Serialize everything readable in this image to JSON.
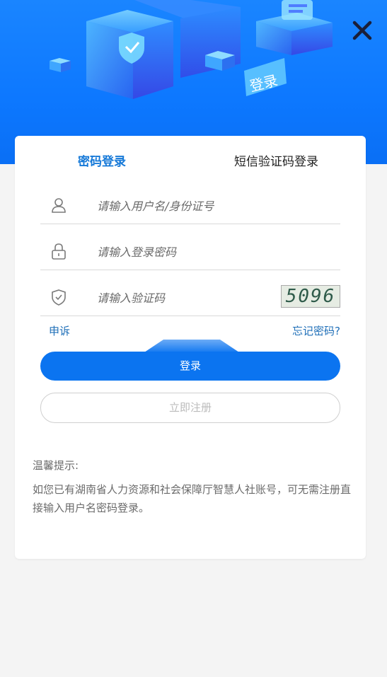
{
  "header": {
    "close_icon": "close-icon",
    "banner_badge": "登录",
    "colors": {
      "primary": "#0b74f0",
      "hero_blue": "#1a85ff",
      "link": "#1f6fb8"
    }
  },
  "tabs": [
    {
      "label": "密码登录",
      "active": true
    },
    {
      "label": "短信验证码登录",
      "active": false
    }
  ],
  "form": {
    "username": {
      "placeholder": "请输入用户名/身份证号",
      "icon": "user-icon"
    },
    "password": {
      "placeholder": "请输入登录密码",
      "icon": "lock-icon"
    },
    "captcha": {
      "placeholder": "请输入验证码",
      "icon": "shield-check-icon",
      "code": "5096"
    }
  },
  "links": {
    "appeal": "申诉",
    "forgot": "忘记密码?"
  },
  "buttons": {
    "login": "登录",
    "register": "立即注册"
  },
  "tips": {
    "title": "温馨提示:",
    "body": "如您已有湖南省人力资源和社会保障厅智慧人社账号，可无需注册直接输入用户名密码登录。"
  }
}
